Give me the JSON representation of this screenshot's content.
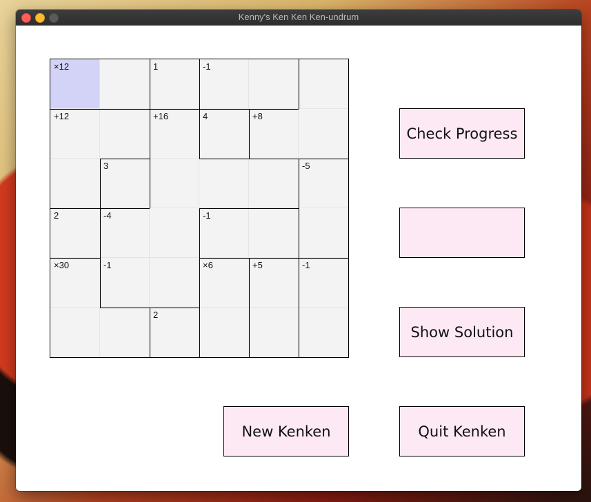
{
  "window": {
    "title": "Kenny's Ken Ken Ken-undrum"
  },
  "buttons": {
    "check_progress": "Check Progress",
    "blank": "",
    "show_solution": "Show Solution",
    "new_kenken": "New Kenken",
    "quit_kenken": "Quit Kenken"
  },
  "puzzle": {
    "size": 6,
    "selected_cell": "r1c1",
    "clues": {
      "r1c1": "×12",
      "r1c3": "1",
      "r1c4": "-1",
      "r2c1": "+12",
      "r2c3": "+16",
      "r2c4": "4",
      "r2c5": "+8",
      "r3c2": "3",
      "r3c6": "-5",
      "r4c1": "2",
      "r4c2": "-4",
      "r4c4": "-1",
      "r5c1": "×30",
      "r5c2": "-1",
      "r5c4": "×6",
      "r5c5": "+5",
      "r5c6": "-1",
      "r6c3": "2"
    }
  },
  "colors": {
    "selected_cell": "#d3d3f7",
    "cell_bg": "#f3f3f3",
    "button_bg": "#fce9f4"
  }
}
